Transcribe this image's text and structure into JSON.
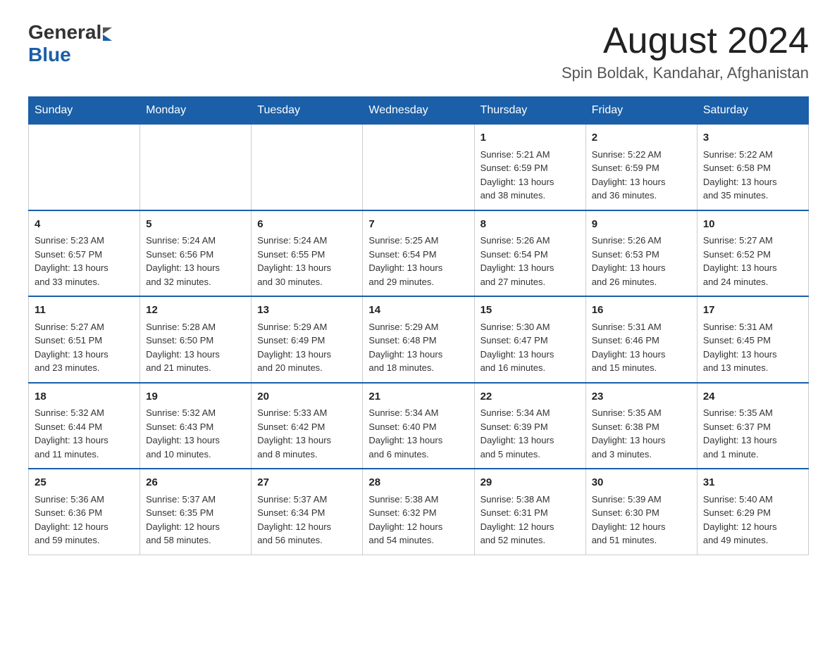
{
  "header": {
    "logo": {
      "general": "General",
      "blue": "Blue"
    },
    "month_year": "August 2024",
    "location": "Spin Boldak, Kandahar, Afghanistan"
  },
  "weekdays": [
    "Sunday",
    "Monday",
    "Tuesday",
    "Wednesday",
    "Thursday",
    "Friday",
    "Saturday"
  ],
  "weeks": [
    [
      {
        "day": "",
        "info": ""
      },
      {
        "day": "",
        "info": ""
      },
      {
        "day": "",
        "info": ""
      },
      {
        "day": "",
        "info": ""
      },
      {
        "day": "1",
        "info": "Sunrise: 5:21 AM\nSunset: 6:59 PM\nDaylight: 13 hours\nand 38 minutes."
      },
      {
        "day": "2",
        "info": "Sunrise: 5:22 AM\nSunset: 6:59 PM\nDaylight: 13 hours\nand 36 minutes."
      },
      {
        "day": "3",
        "info": "Sunrise: 5:22 AM\nSunset: 6:58 PM\nDaylight: 13 hours\nand 35 minutes."
      }
    ],
    [
      {
        "day": "4",
        "info": "Sunrise: 5:23 AM\nSunset: 6:57 PM\nDaylight: 13 hours\nand 33 minutes."
      },
      {
        "day": "5",
        "info": "Sunrise: 5:24 AM\nSunset: 6:56 PM\nDaylight: 13 hours\nand 32 minutes."
      },
      {
        "day": "6",
        "info": "Sunrise: 5:24 AM\nSunset: 6:55 PM\nDaylight: 13 hours\nand 30 minutes."
      },
      {
        "day": "7",
        "info": "Sunrise: 5:25 AM\nSunset: 6:54 PM\nDaylight: 13 hours\nand 29 minutes."
      },
      {
        "day": "8",
        "info": "Sunrise: 5:26 AM\nSunset: 6:54 PM\nDaylight: 13 hours\nand 27 minutes."
      },
      {
        "day": "9",
        "info": "Sunrise: 5:26 AM\nSunset: 6:53 PM\nDaylight: 13 hours\nand 26 minutes."
      },
      {
        "day": "10",
        "info": "Sunrise: 5:27 AM\nSunset: 6:52 PM\nDaylight: 13 hours\nand 24 minutes."
      }
    ],
    [
      {
        "day": "11",
        "info": "Sunrise: 5:27 AM\nSunset: 6:51 PM\nDaylight: 13 hours\nand 23 minutes."
      },
      {
        "day": "12",
        "info": "Sunrise: 5:28 AM\nSunset: 6:50 PM\nDaylight: 13 hours\nand 21 minutes."
      },
      {
        "day": "13",
        "info": "Sunrise: 5:29 AM\nSunset: 6:49 PM\nDaylight: 13 hours\nand 20 minutes."
      },
      {
        "day": "14",
        "info": "Sunrise: 5:29 AM\nSunset: 6:48 PM\nDaylight: 13 hours\nand 18 minutes."
      },
      {
        "day": "15",
        "info": "Sunrise: 5:30 AM\nSunset: 6:47 PM\nDaylight: 13 hours\nand 16 minutes."
      },
      {
        "day": "16",
        "info": "Sunrise: 5:31 AM\nSunset: 6:46 PM\nDaylight: 13 hours\nand 15 minutes."
      },
      {
        "day": "17",
        "info": "Sunrise: 5:31 AM\nSunset: 6:45 PM\nDaylight: 13 hours\nand 13 minutes."
      }
    ],
    [
      {
        "day": "18",
        "info": "Sunrise: 5:32 AM\nSunset: 6:44 PM\nDaylight: 13 hours\nand 11 minutes."
      },
      {
        "day": "19",
        "info": "Sunrise: 5:32 AM\nSunset: 6:43 PM\nDaylight: 13 hours\nand 10 minutes."
      },
      {
        "day": "20",
        "info": "Sunrise: 5:33 AM\nSunset: 6:42 PM\nDaylight: 13 hours\nand 8 minutes."
      },
      {
        "day": "21",
        "info": "Sunrise: 5:34 AM\nSunset: 6:40 PM\nDaylight: 13 hours\nand 6 minutes."
      },
      {
        "day": "22",
        "info": "Sunrise: 5:34 AM\nSunset: 6:39 PM\nDaylight: 13 hours\nand 5 minutes."
      },
      {
        "day": "23",
        "info": "Sunrise: 5:35 AM\nSunset: 6:38 PM\nDaylight: 13 hours\nand 3 minutes."
      },
      {
        "day": "24",
        "info": "Sunrise: 5:35 AM\nSunset: 6:37 PM\nDaylight: 13 hours\nand 1 minute."
      }
    ],
    [
      {
        "day": "25",
        "info": "Sunrise: 5:36 AM\nSunset: 6:36 PM\nDaylight: 12 hours\nand 59 minutes."
      },
      {
        "day": "26",
        "info": "Sunrise: 5:37 AM\nSunset: 6:35 PM\nDaylight: 12 hours\nand 58 minutes."
      },
      {
        "day": "27",
        "info": "Sunrise: 5:37 AM\nSunset: 6:34 PM\nDaylight: 12 hours\nand 56 minutes."
      },
      {
        "day": "28",
        "info": "Sunrise: 5:38 AM\nSunset: 6:32 PM\nDaylight: 12 hours\nand 54 minutes."
      },
      {
        "day": "29",
        "info": "Sunrise: 5:38 AM\nSunset: 6:31 PM\nDaylight: 12 hours\nand 52 minutes."
      },
      {
        "day": "30",
        "info": "Sunrise: 5:39 AM\nSunset: 6:30 PM\nDaylight: 12 hours\nand 51 minutes."
      },
      {
        "day": "31",
        "info": "Sunrise: 5:40 AM\nSunset: 6:29 PM\nDaylight: 12 hours\nand 49 minutes."
      }
    ]
  ]
}
